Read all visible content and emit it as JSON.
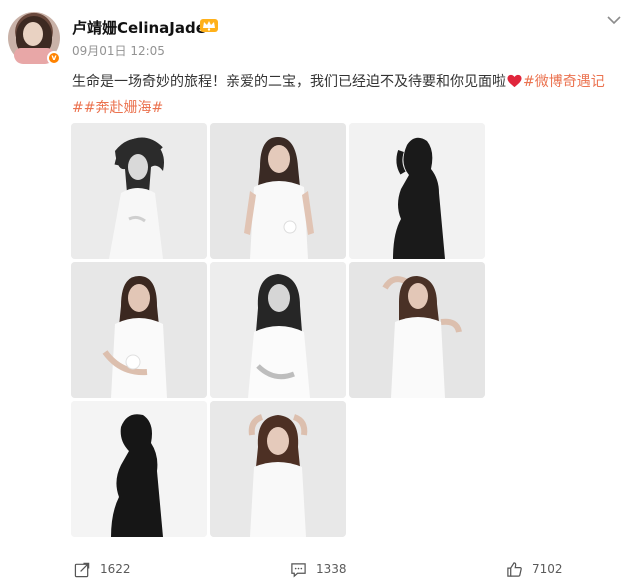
{
  "post": {
    "username": "卢靖姗CelinaJade",
    "timestamp": "09月01日 12:05",
    "text": "生命是一场奇妙的旅程！亲爱的二宝，我们已经迫不及待要和你见面啦",
    "hashtag1": "#微博奇遇记",
    "hashtag2": "##奔赴姗海#",
    "photo_count": 8
  },
  "actions": {
    "share_count": "1622",
    "comment_count": "1338",
    "like_count": "7102"
  },
  "icons": {
    "verified": "verified-badge-icon",
    "vip": "crown-icon",
    "menu": "chevron-down-icon",
    "emoji": "red-heart-icon",
    "share": "share-icon",
    "comment": "comment-icon",
    "like": "thumbs-up-icon"
  },
  "colors": {
    "hashtag": "#eb7350",
    "badge": "#ff8200",
    "heart": "#e0263c"
  }
}
